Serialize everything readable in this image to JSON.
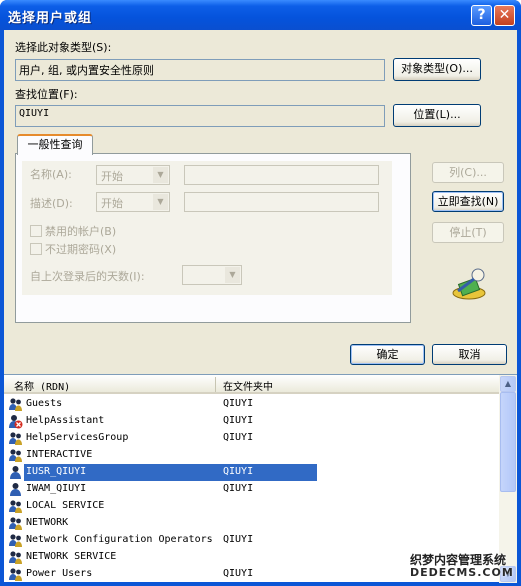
{
  "window": {
    "title": "选择用户或组",
    "help_glyph": "?",
    "close_glyph": "✕"
  },
  "object_type": {
    "label": "选择此对象类型(S):",
    "value": "用户, 组, 或内置安全性原则",
    "button": "对象类型(O)..."
  },
  "location": {
    "label": "查找位置(F):",
    "value": "QIUYI",
    "button": "位置(L)..."
  },
  "tab": {
    "label": "一般性查询"
  },
  "query": {
    "name_label": "名称(A):",
    "name_mode": "开始",
    "desc_label": "描述(D):",
    "desc_mode": "开始",
    "disabled_accounts": "禁用的帐户(B)",
    "no_expire_pwd": "不过期密码(X)",
    "days_label": "自上次登录后的天数(I):",
    "days_value": ""
  },
  "side_buttons": {
    "columns": "列(C)...",
    "find_now": "立即查找(N)",
    "stop": "停止(T)"
  },
  "footer": {
    "ok": "确定",
    "cancel": "取消"
  },
  "results": {
    "columns": [
      "名称 (RDN)",
      "在文件夹中"
    ],
    "rows": [
      {
        "name": "Guests",
        "folder": "QIUYI",
        "icon": "group-icon",
        "selected": false
      },
      {
        "name": "HelpAssistant",
        "folder": "QIUYI",
        "icon": "disabled-user-icon",
        "selected": false
      },
      {
        "name": "HelpServicesGroup",
        "folder": "QIUYI",
        "icon": "group-icon",
        "selected": false
      },
      {
        "name": "INTERACTIVE",
        "folder": "",
        "icon": "group-icon",
        "selected": false
      },
      {
        "name": "IUSR_QIUYI",
        "folder": "QIUYI",
        "icon": "user-icon",
        "selected": true
      },
      {
        "name": "IWAM_QIUYI",
        "folder": "QIUYI",
        "icon": "user-icon",
        "selected": false
      },
      {
        "name": "LOCAL SERVICE",
        "folder": "",
        "icon": "group-icon",
        "selected": false
      },
      {
        "name": "NETWORK",
        "folder": "",
        "icon": "group-icon",
        "selected": false
      },
      {
        "name": "Network Configuration Operators",
        "folder": "QIUYI",
        "icon": "group-icon",
        "selected": false
      },
      {
        "name": "NETWORK SERVICE",
        "folder": "",
        "icon": "group-icon",
        "selected": false
      },
      {
        "name": "Power Users",
        "folder": "QIUYI",
        "icon": "group-icon",
        "selected": false
      }
    ]
  },
  "watermark": {
    "line1": "织梦内容管理系统",
    "line2": "DEDECMS.COM"
  },
  "colors": {
    "titlebar": "#0553dc",
    "selection": "#316ac5",
    "dialog_bg": "#ece9d8"
  }
}
